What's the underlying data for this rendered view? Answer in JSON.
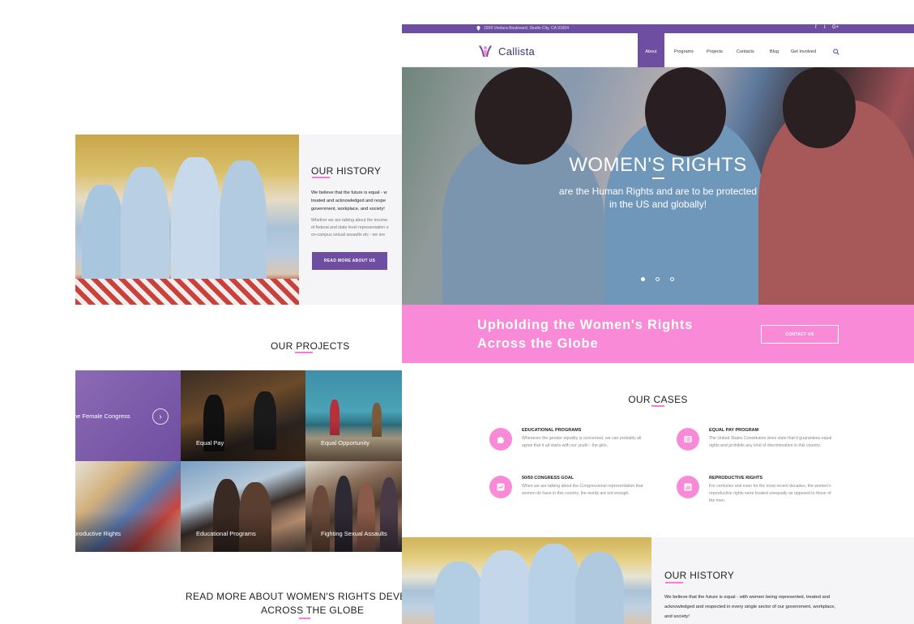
{
  "back_page": {
    "history": {
      "title": "OUR HISTORY",
      "lead_lines": [
        "We believe that the future is equal - w",
        "treated and acknowledged and respe",
        "government, workplace, and society!"
      ],
      "body_lines": [
        "Whether we are talking about the income",
        "of federal and state level representation o",
        "on-campus sexual assaults etc - we are"
      ],
      "button": "READ MORE ABOUT US"
    },
    "projects": {
      "title": "OUR PROJECTS",
      "tiles": [
        {
          "label": "he Female Congress"
        },
        {
          "label": "Equal Pay"
        },
        {
          "label": "Equal Opportunity"
        },
        {
          "label": "productive Rights"
        },
        {
          "label": "Educational Programs"
        },
        {
          "label": "Fighting Sexual Assaults"
        }
      ]
    },
    "read_more": {
      "line1": "READ MORE ABOUT WOMEN'S RIGHTS DEVELOPM",
      "line2": "ACROSS THE GLOBE"
    }
  },
  "front_page": {
    "topbar": {
      "address": "1559 Ventura Boulevard, Studio City, CA 91604",
      "social": [
        "f",
        "t",
        "G+"
      ]
    },
    "logo": "Callista",
    "nav": {
      "active": "About",
      "items": [
        "Programs",
        "Projects",
        "Contacts",
        "Blog",
        "Get Involved"
      ]
    },
    "hero": {
      "title": "WOMEN'S RIGHTS",
      "subtitle_line1": "are the Human Rights and are to be protected",
      "subtitle_line2": "in the US and globally!",
      "slides_total": 3,
      "active_slide": 1
    },
    "cta": {
      "line1": "Upholding the Women's Rights",
      "line2": "Across the Globe",
      "button": "CONTACT US"
    },
    "cases": {
      "title": "OUR CASES",
      "items": [
        {
          "title": "EDUCATIONAL PROGRAMS",
          "text": "Whenever the gender equality is concerned, we can probably all agree that it all starts with our youth - the girls.",
          "icon": "puzzle-icon"
        },
        {
          "title": "EQUAL PAY PROGRAM",
          "text": "The United States Constitution does state that it guarantees equal rights and prohibits any kind of discrimination in this country.",
          "icon": "list-icon"
        },
        {
          "title": "50/50 CONGRESS GOAL",
          "text": "When we are talking about the Congressional representation that women do have in this country, the words are not enough.",
          "icon": "chart-icon"
        },
        {
          "title": "REPRODUCTIVE RIGHTS",
          "text": "For centuries and even for the most recent decades, the women's reproductive rights were treated unequally as opposed to those of the men.",
          "icon": "bar-chart-icon"
        }
      ]
    },
    "history": {
      "title": "OUR HISTORY",
      "text": "We believe that the future is equal - with women being represented, treated and acknowledged and respected in every single sector of our government, workplace, and society!"
    }
  },
  "colors": {
    "purple": "#6e4ea0",
    "pink": "#f98ad7",
    "accent_line": "#f57bd4"
  }
}
